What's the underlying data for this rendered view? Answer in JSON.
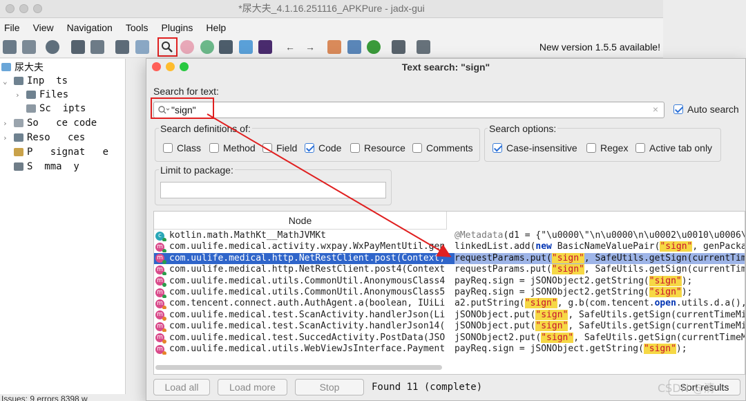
{
  "window": {
    "title": "*尿大夫_4.1.16.251116_APKPure - jadx-gui"
  },
  "menu": [
    "File",
    "View",
    "Navigation",
    "Tools",
    "Plugins",
    "Help"
  ],
  "toolbar": {
    "new_version": "New version 1.5.5 available!"
  },
  "sidebar": {
    "root": "尿大夫",
    "items": [
      {
        "label": "Inp  ts",
        "chev": "⌄"
      },
      {
        "label": "Files",
        "chev": "›"
      },
      {
        "label": "Sc  ipts",
        "chev": ""
      },
      {
        "label": "So   ce code",
        "chev": "›"
      },
      {
        "label": "Reso   ces",
        "chev": "›"
      },
      {
        "label": "P   signat   e",
        "chev": ""
      },
      {
        "label": "S  mma  y",
        "chev": ""
      }
    ],
    "status": "Issues:  9 errors  8398 w"
  },
  "dialog": {
    "title": "Text search: \"sign\"",
    "search_label": "Search for text:",
    "search_value": "\"sign\"",
    "auto_search": "Auto search",
    "defs_label": "Search definitions of:",
    "defs": [
      "Class",
      "Method",
      "Field",
      "Code",
      "Resource",
      "Comments"
    ],
    "options_label": "Search options:",
    "options": [
      "Case-insensitive",
      "Regex",
      "Active tab only"
    ],
    "limit_label": "Limit to package:",
    "node_header": "Node",
    "rows": [
      {
        "node": "kotlin.math.MathKt__MathJVMKt",
        "code": "@Metadata(d1 = {\"\\u0000\\\"\\n\\u0000\\n\\u0002\\u0010\\u0006\\"
      },
      {
        "node": "com.uulife.medical.activity.wxpay.WxPayMentUtil.genPa",
        "code": "linkedList.add(new BasicNameValuePair(\"sign\", genPacka"
      },
      {
        "node": "com.uulife.medical.http.NetRestClient.post(Context, S",
        "code": "requestParams.put(\"sign\", SafeUtils.getSign(currentTim"
      },
      {
        "node": "com.uulife.medical.http.NetRestClient.post4(Context,",
        "code": "requestParams.put(\"sign\", SafeUtils.getSign(currentTim"
      },
      {
        "node": "com.uulife.medical.utils.CommonUtil.AnonymousClass4.c",
        "code": "payReq.sign = jSONObject2.getString(\"sign\");"
      },
      {
        "node": "com.uulife.medical.utils.CommonUtil.AnonymousClass5.c",
        "code": "payReq.sign = jSONObject2.getString(\"sign\");"
      },
      {
        "node": "com.tencent.connect.auth.AuthAgent.a(boolean, IUiList",
        "code": "a2.putString(\"sign\", g.b(com.tencent.open.utils.d.a(),"
      },
      {
        "node": "com.uulife.medical.test.ScanActivity.handlerJson(List",
        "code": "jSONObject.put(\"sign\", SafeUtils.getSign(currentTimeMi"
      },
      {
        "node": "com.uulife.medical.test.ScanActivity.handlerJson14(Bi",
        "code": "jSONObject.put(\"sign\", SafeUtils.getSign(currentTimeMi"
      },
      {
        "node": "com.uulife.medical.test.SuccedActivity.PostData(JSONO",
        "code": "jSONObject2.put(\"sign\", SafeUtils.getSign(currentTimeM"
      },
      {
        "node": "com.uulife.medical.utils.WebViewJsInterface.Payment(J",
        "code": "payReq.sign = jSONObject.getString(\"sign\");"
      }
    ],
    "buttons": {
      "load_all": "Load all",
      "load_more": "Load more",
      "stop": "Stop",
      "sort": "Sort results"
    },
    "found": "Found 11 (complete)"
  },
  "watermark": "CSDN @清",
  "colors": {
    "selection": "#2f65ca",
    "highlight": "#f6d845",
    "annotation_red": "#e02020"
  }
}
